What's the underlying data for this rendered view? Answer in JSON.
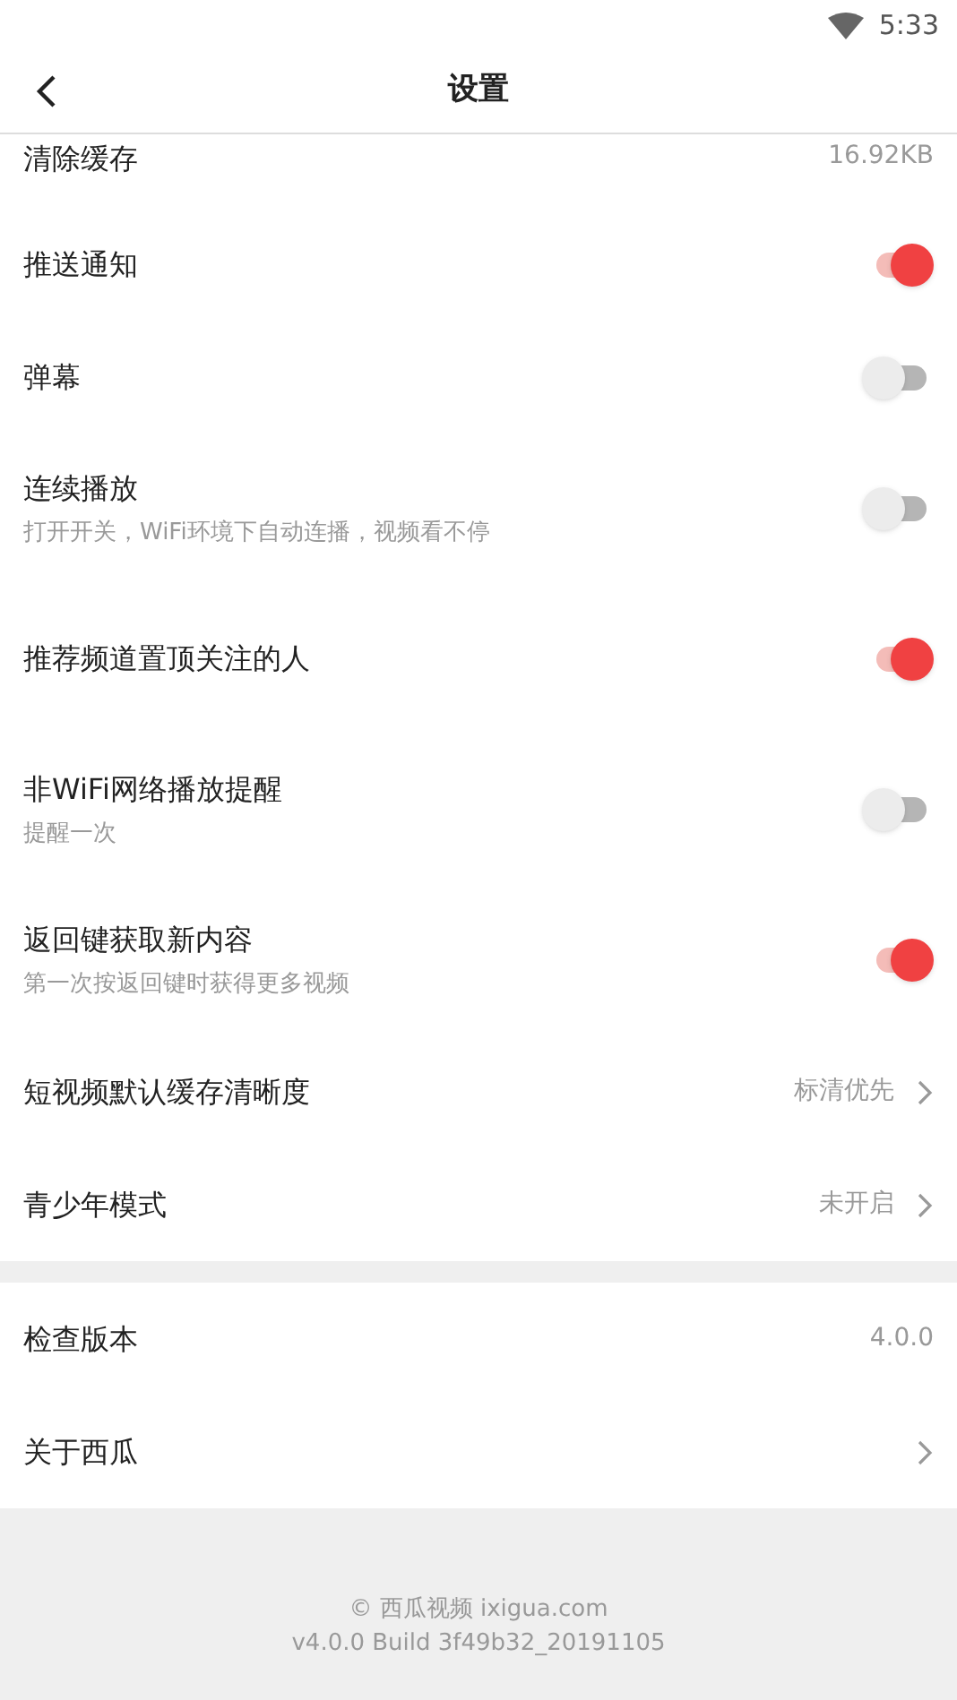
{
  "status_bar": {
    "time": "5:33"
  },
  "header": {
    "title": "设置"
  },
  "sections": [
    {
      "items": [
        {
          "kind": "value",
          "title": "清除缓存",
          "value": "16.92KB",
          "cut": true
        },
        {
          "kind": "toggle",
          "title": "推送通知",
          "on": true
        },
        {
          "kind": "toggle",
          "title": "弹幕",
          "on": false
        },
        {
          "kind": "toggle",
          "title": "连续播放",
          "subtitle": "打开开关，WiFi环境下自动连播，视频看不停",
          "on": false
        },
        {
          "kind": "toggle",
          "title": "推荐频道置顶关注的人",
          "on": true,
          "tall": true
        },
        {
          "kind": "toggle",
          "title": "非WiFi网络播放提醒",
          "subtitle": "提醒一次",
          "on": false
        },
        {
          "kind": "toggle",
          "title": "返回键获取新内容",
          "subtitle": "第一次按返回键时获得更多视频",
          "on": true
        },
        {
          "kind": "link",
          "title": "短视频默认缓存清晰度",
          "value": "标清优先"
        },
        {
          "kind": "link",
          "title": "青少年模式",
          "value": "未开启"
        }
      ]
    },
    {
      "items": [
        {
          "kind": "value",
          "title": "检查版本",
          "value": "4.0.0"
        },
        {
          "kind": "link",
          "title": "关于西瓜"
        }
      ]
    }
  ],
  "footer": {
    "lines": [
      "© 西瓜视频 ixigua.com",
      "v4.0.0 Build 3f49b32_20191105"
    ]
  }
}
